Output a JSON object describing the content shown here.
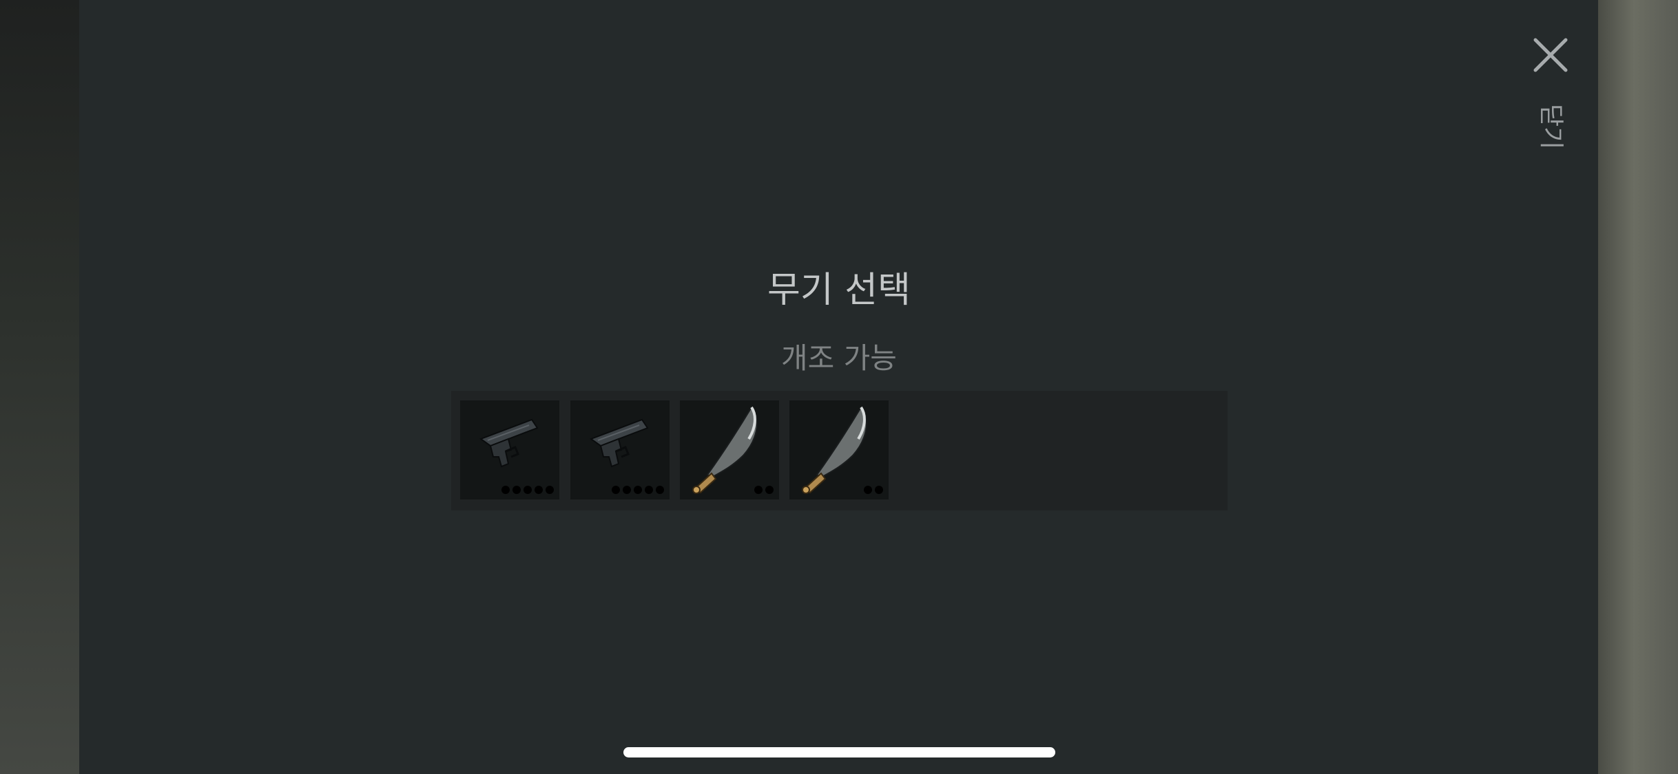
{
  "header": {
    "close_label": "닫기",
    "close_icon": "close-x-icon"
  },
  "dialog": {
    "title": "무기 선택",
    "subtitle": "개조 가능"
  },
  "weapons": [
    {
      "icon": "pistol-icon",
      "level": 5
    },
    {
      "icon": "pistol-icon",
      "level": 5
    },
    {
      "icon": "machete-icon",
      "level": 2
    },
    {
      "icon": "machete-icon",
      "level": 2
    }
  ],
  "colors": {
    "panel": "#252a2b",
    "title": "#c4c7c8",
    "subtitle": "#7f8384",
    "slot": "#131616"
  }
}
